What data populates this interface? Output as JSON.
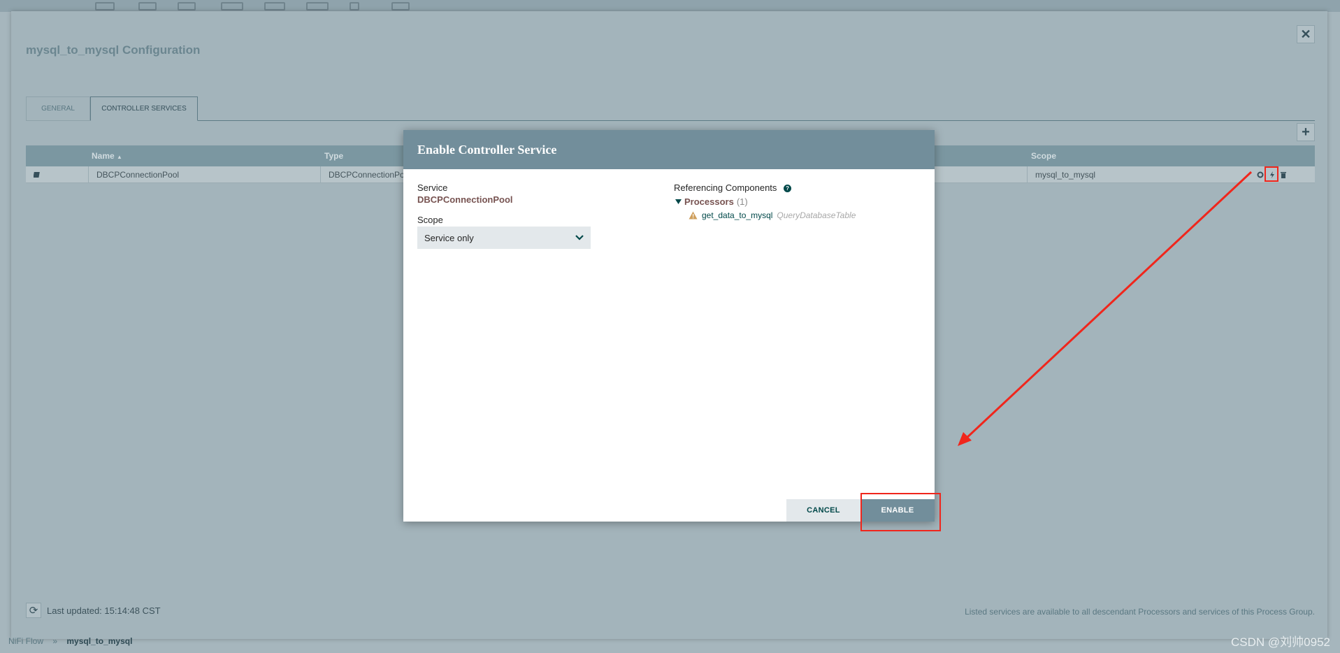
{
  "config": {
    "title": "mysql_to_mysql Configuration",
    "close_label": "✕",
    "tabs": [
      {
        "label": "GENERAL"
      },
      {
        "label": "CONTROLLER SERVICES"
      }
    ],
    "table": {
      "headers": {
        "name": "Name",
        "sort": "▲",
        "type": "Type",
        "scope": "Scope"
      },
      "rows": [
        {
          "name": "DBCPConnectionPool",
          "type": "DBCPConnectionPo",
          "scope": "mysql_to_mysql"
        }
      ]
    },
    "footer": {
      "last_updated": "Last updated: 15:14:48 CST",
      "note": "Listed services are available to all descendant Processors and services of this Process Group."
    }
  },
  "breadcrumb": {
    "root": "NiFi Flow",
    "separator": "»",
    "current": "mysql_to_mysql"
  },
  "watermark": "CSDN @刘帅0952",
  "modal": {
    "title": "Enable Controller Service",
    "service_label": "Service",
    "service_value": "DBCPConnectionPool",
    "scope_label": "Scope",
    "scope_value": "Service only",
    "ref_label": "Referencing Components",
    "ref_help": "?",
    "processors_label": "Processors",
    "processors_count": "(1)",
    "processor_name": "get_data_to_mysql",
    "processor_type": "QueryDatabaseTable",
    "cancel_label": "CANCEL",
    "enable_label": "ENABLE"
  },
  "colors": {
    "modal_header": "#728e9b",
    "annotation_red": "#f0261c",
    "service_value": "#775351",
    "accent": "#004849"
  }
}
